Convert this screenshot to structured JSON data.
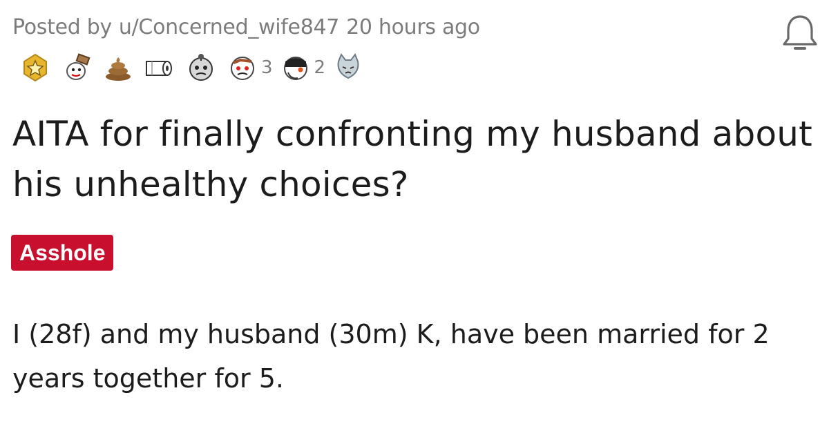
{
  "post": {
    "posted_by_prefix": "Posted by",
    "username": "u/Concerned_wife847",
    "time_ago": "20 hours ago",
    "awards": [
      {
        "name": "gold-award-icon"
      },
      {
        "name": "wholesome-seal-award-icon"
      },
      {
        "name": "poop-award-icon"
      },
      {
        "name": "toilet-paper-award-icon"
      },
      {
        "name": "dead-face-award-icon"
      },
      {
        "name": "angry-upvote-award-icon",
        "count": "3"
      },
      {
        "name": "facepalm-award-icon",
        "count": "2"
      },
      {
        "name": "sad-cat-award-icon"
      }
    ],
    "title": "AITA for finally confronting my husband about his unhealthy choices?",
    "flair": "Asshole",
    "body": "I (28f) and my husband (30m) K, have been married for 2 years together for 5.",
    "colors": {
      "flair_bg": "#c8102e",
      "meta_text": "#7c7c7c",
      "title_text": "#1c1c1c"
    }
  }
}
